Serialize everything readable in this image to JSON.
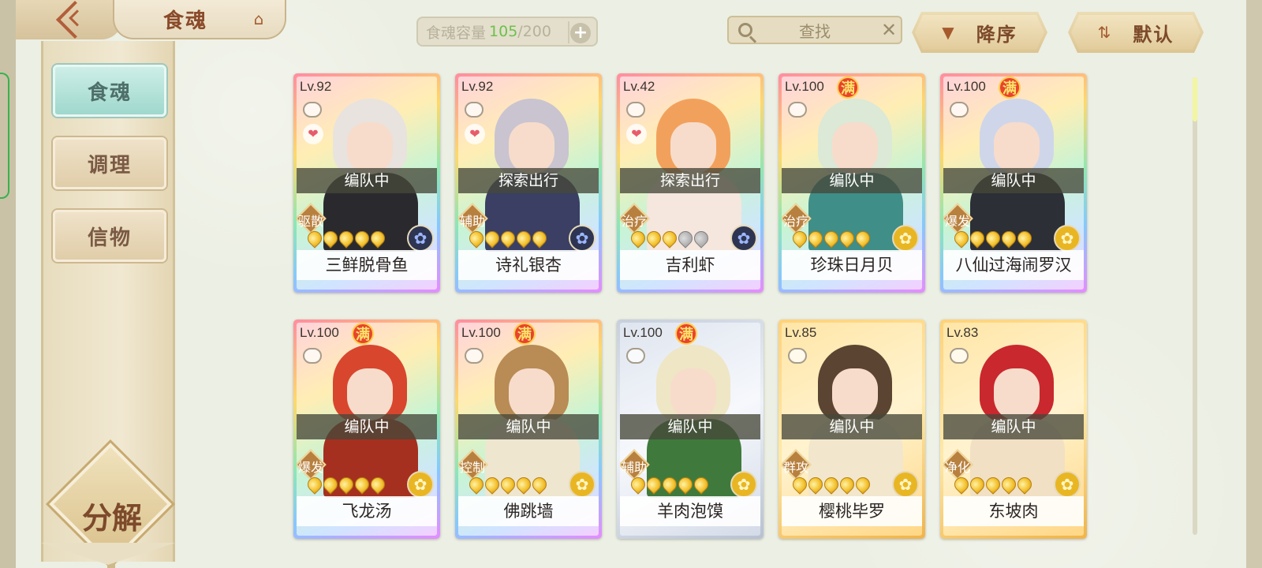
{
  "header": {
    "title": "食魂",
    "capacity_label": "食魂容量",
    "capacity_current": "105",
    "capacity_max": "/200",
    "search_label": "查找",
    "sort_desc_label": "降序",
    "sort_default_label": "默认"
  },
  "sidebar": {
    "items": [
      {
        "label": "食魂",
        "active": true
      },
      {
        "label": "调理",
        "active": false
      },
      {
        "label": "信物",
        "active": false
      }
    ],
    "decompose_label": "分解"
  },
  "cards": [
    {
      "level": "Lv.92",
      "full": "",
      "status": "编队中",
      "role": "驱散",
      "name": "三鲜脱骨鱼",
      "stars": 5,
      "element": "dark",
      "heart": true,
      "rarity": "rainbow",
      "palette": {
        "hair": "#e8e3de",
        "body": "#2a2a2e"
      }
    },
    {
      "level": "Lv.92",
      "full": "",
      "status": "探索出行",
      "role": "辅助",
      "name": "诗礼银杏",
      "stars": 5,
      "element": "dark",
      "heart": true,
      "rarity": "rainbow",
      "palette": {
        "hair": "#c9c4d0",
        "body": "#3a3f63"
      }
    },
    {
      "level": "Lv.42",
      "full": "",
      "status": "探索出行",
      "role": "治疗",
      "name": "吉利虾",
      "stars": 3,
      "element": "dark",
      "heart": true,
      "rarity": "rainbow",
      "palette": {
        "hair": "#f2a15c",
        "body": "#f5e6de"
      }
    },
    {
      "level": "Lv.100",
      "full": "满",
      "status": "编队中",
      "role": "治疗",
      "name": "珍珠日月贝",
      "stars": 5,
      "element": "gold",
      "heart": false,
      "rarity": "rainbow",
      "palette": {
        "hair": "#dbe9d6",
        "body": "#3f8e88"
      }
    },
    {
      "level": "Lv.100",
      "full": "满",
      "status": "编队中",
      "role": "爆发",
      "name": "八仙过海闹罗汉",
      "stars": 5,
      "element": "gold",
      "heart": false,
      "rarity": "rainbow",
      "palette": {
        "hair": "#cfd6ea",
        "body": "#2c2f35"
      }
    },
    {
      "level": "Lv.100",
      "full": "满",
      "status": "编队中",
      "role": "爆发",
      "name": "飞龙汤",
      "stars": 5,
      "element": "gold",
      "heart": false,
      "rarity": "rainbow",
      "palette": {
        "hair": "#d8462e",
        "body": "#a5301f"
      }
    },
    {
      "level": "Lv.100",
      "full": "满",
      "status": "编队中",
      "role": "控制",
      "name": "佛跳墙",
      "stars": 5,
      "element": "gold",
      "heart": false,
      "rarity": "rainbow",
      "palette": {
        "hair": "#b98b55",
        "body": "#efe6cf"
      }
    },
    {
      "level": "Lv.100",
      "full": "满",
      "status": "编队中",
      "role": "辅助",
      "name": "羊肉泡馍",
      "stars": 5,
      "element": "gold",
      "heart": false,
      "rarity": "silver",
      "palette": {
        "hair": "#eee6c5",
        "body": "#3f7a3c"
      }
    },
    {
      "level": "Lv.85",
      "full": "",
      "status": "编队中",
      "role": "群攻",
      "name": "樱桃毕罗",
      "stars": 5,
      "element": "gold",
      "heart": false,
      "rarity": "gold",
      "palette": {
        "hair": "#5b4432",
        "body": "#f2e7cc"
      }
    },
    {
      "level": "Lv.83",
      "full": "",
      "status": "编队中",
      "role": "净化",
      "name": "东坡肉",
      "stars": 5,
      "element": "gold",
      "heart": false,
      "rarity": "gold",
      "palette": {
        "hair": "#c9282e",
        "body": "#f1e0c3"
      }
    }
  ],
  "colors": {
    "accent_teal": "#9fd8cd",
    "status_bar": "#46483a",
    "capacity_green": "#6ec04d"
  }
}
